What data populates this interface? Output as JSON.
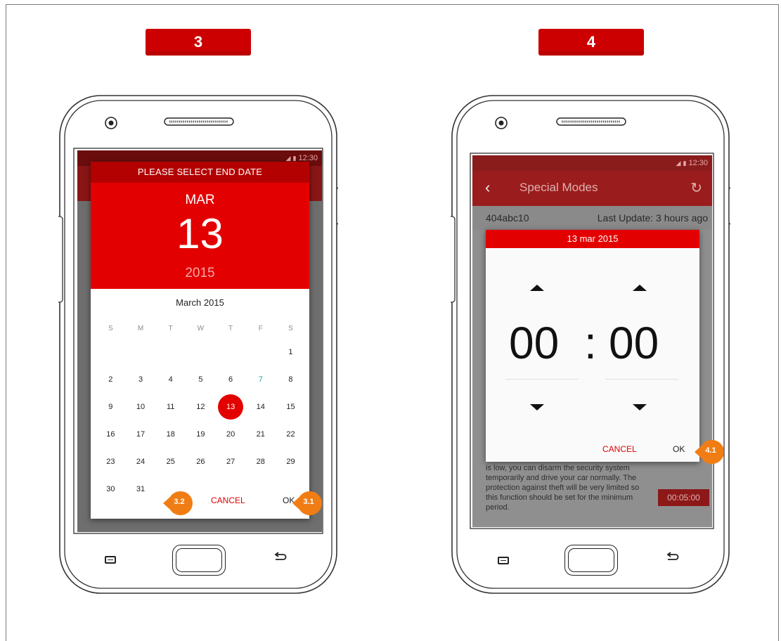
{
  "steps": [
    {
      "badge": "3",
      "status_time": "12:30",
      "dialog": {
        "title": "PLEASE SELECT END DATE",
        "month": "MAR",
        "day": "13",
        "year": "2015",
        "calendar_title": "March 2015",
        "weekdays": [
          "S",
          "M",
          "T",
          "W",
          "T",
          "F",
          "S"
        ],
        "weeks": [
          [
            "",
            "",
            "",
            "",
            "",
            "",
            "1"
          ],
          [
            "2",
            "3",
            "4",
            "5",
            "6",
            "7",
            "8"
          ],
          [
            "9",
            "10",
            "11",
            "12",
            "13",
            "14",
            "15"
          ],
          [
            "16",
            "17",
            "18",
            "19",
            "20",
            "21",
            "22"
          ],
          [
            "23",
            "24",
            "25",
            "26",
            "27",
            "28",
            "29"
          ],
          [
            "30",
            "31",
            "",
            "",
            "",
            "",
            ""
          ]
        ],
        "selected_day": "13",
        "today_day": "7",
        "cancel_label": "CANCEL",
        "ok_label": "OK"
      },
      "annotations": {
        "cancel": "3.2",
        "ok": "3.1"
      }
    },
    {
      "badge": "4",
      "status_time": "12:30",
      "app_title": "Special Modes",
      "device_id": "404abc10",
      "last_update": "Last Update: 3 hours ago",
      "description": "is low, you can disarm the security system temporarily and drive your car normally. The protection against theft will be very limited so this function should be set for the minimum period.",
      "timer_value": "00:05:00",
      "dialog": {
        "date_header": "13 mar 2015",
        "hours": "00",
        "separator": ":",
        "minutes": "00",
        "cancel_label": "CANCEL",
        "ok_label": "OK"
      },
      "annotations": {
        "ok": "4.1"
      }
    }
  ],
  "colors": {
    "brand_red": "#e30000",
    "badge_red": "#cc0000",
    "pin_orange": "#f07d14"
  },
  "icons": [
    "back-chevron-icon",
    "refresh-icon",
    "signal-icon",
    "battery-icon",
    "camera-icon",
    "speaker-grille-icon",
    "menu-key-icon",
    "home-key-icon",
    "back-key-icon"
  ]
}
